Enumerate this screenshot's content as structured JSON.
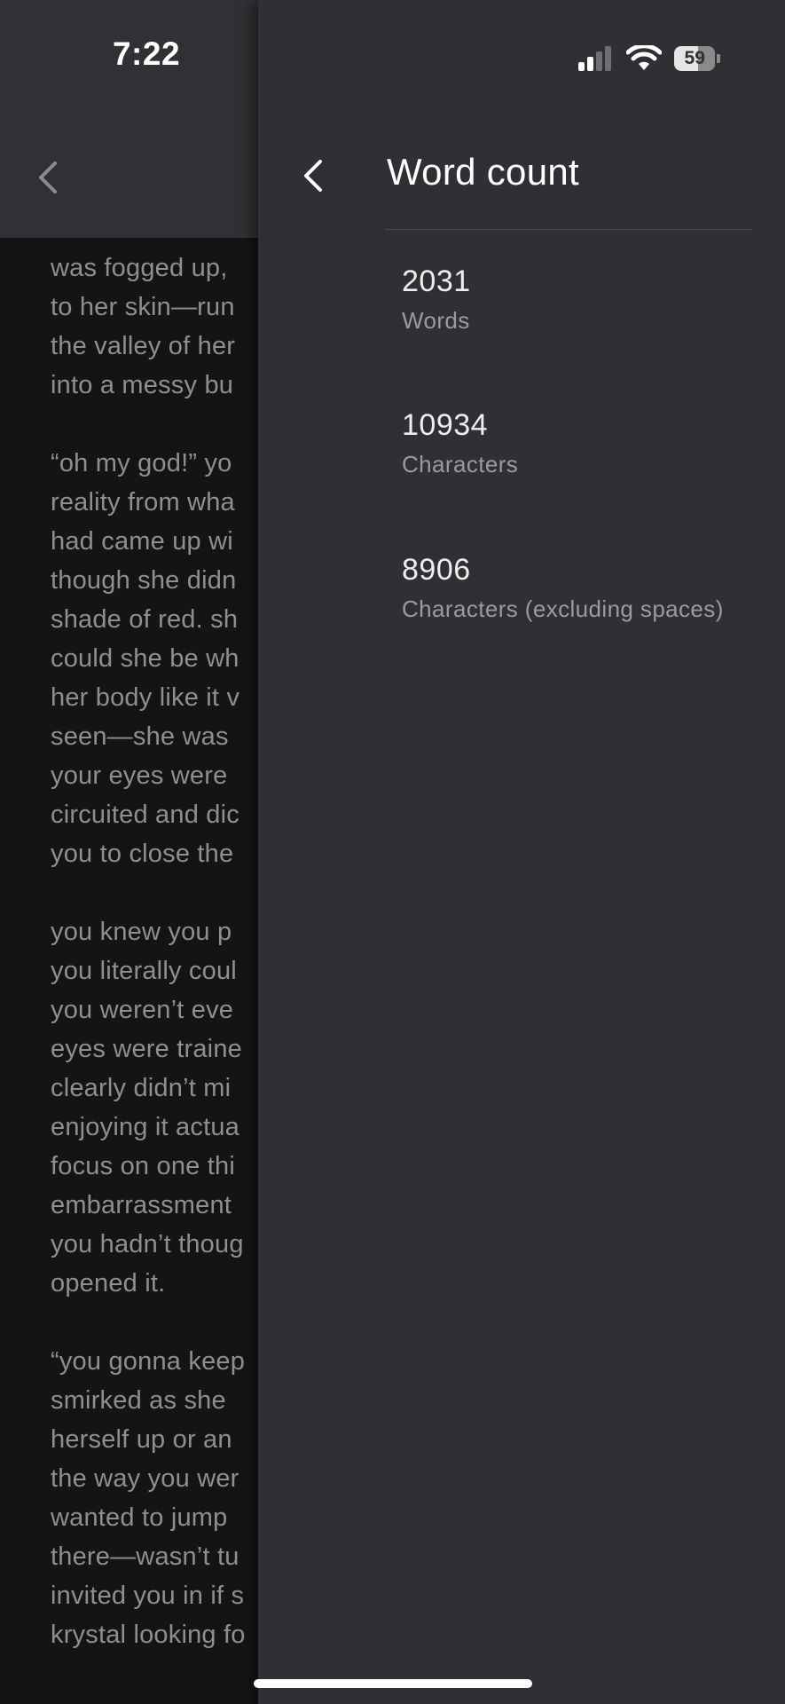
{
  "status_bar": {
    "time": "7:22",
    "battery_level": "59",
    "battery_fraction": 0.59,
    "icons": [
      "cellular-signal-icon",
      "wifi-icon",
      "battery-icon"
    ]
  },
  "document": {
    "back_icon": "chevron-left-icon",
    "visible_lines": [
      "was fogged up,",
      "to her skin—run",
      "the valley of her",
      "into a messy bu",
      "",
      "“oh my god!” yo",
      "reality from wha",
      "had came up wi",
      "though she didn",
      "shade of red. sh",
      "could she be wh",
      "her body like it v",
      "seen—she was",
      "your eyes were",
      "circuited and dic",
      "you to close the",
      "",
      "you knew you p",
      "you literally coul",
      "you weren’t eve",
      "eyes were traine",
      "clearly didn’t mi",
      "enjoying it actua",
      "focus on one thi",
      "embarrassment",
      "you hadn’t thoug",
      "opened it.",
      "",
      "“you gonna keep",
      "smirked as she",
      "herself up or an",
      "the way you wer",
      "wanted to jump",
      "there—wasn’t tu",
      "invited you in if s",
      "krystal looking fo"
    ]
  },
  "drawer": {
    "back_icon": "chevron-left-icon",
    "title": "Word count",
    "stats": [
      {
        "value": "2031",
        "label": "Words"
      },
      {
        "value": "10934",
        "label": "Characters"
      },
      {
        "value": "8906",
        "label": "Characters (excluding spaces)"
      }
    ]
  },
  "colors": {
    "drawer_background": "#2f3034",
    "document_background": "#131416",
    "document_text": "#8f8f90",
    "primary_text": "#ffffff",
    "secondary_text": "#9a9ba0"
  }
}
